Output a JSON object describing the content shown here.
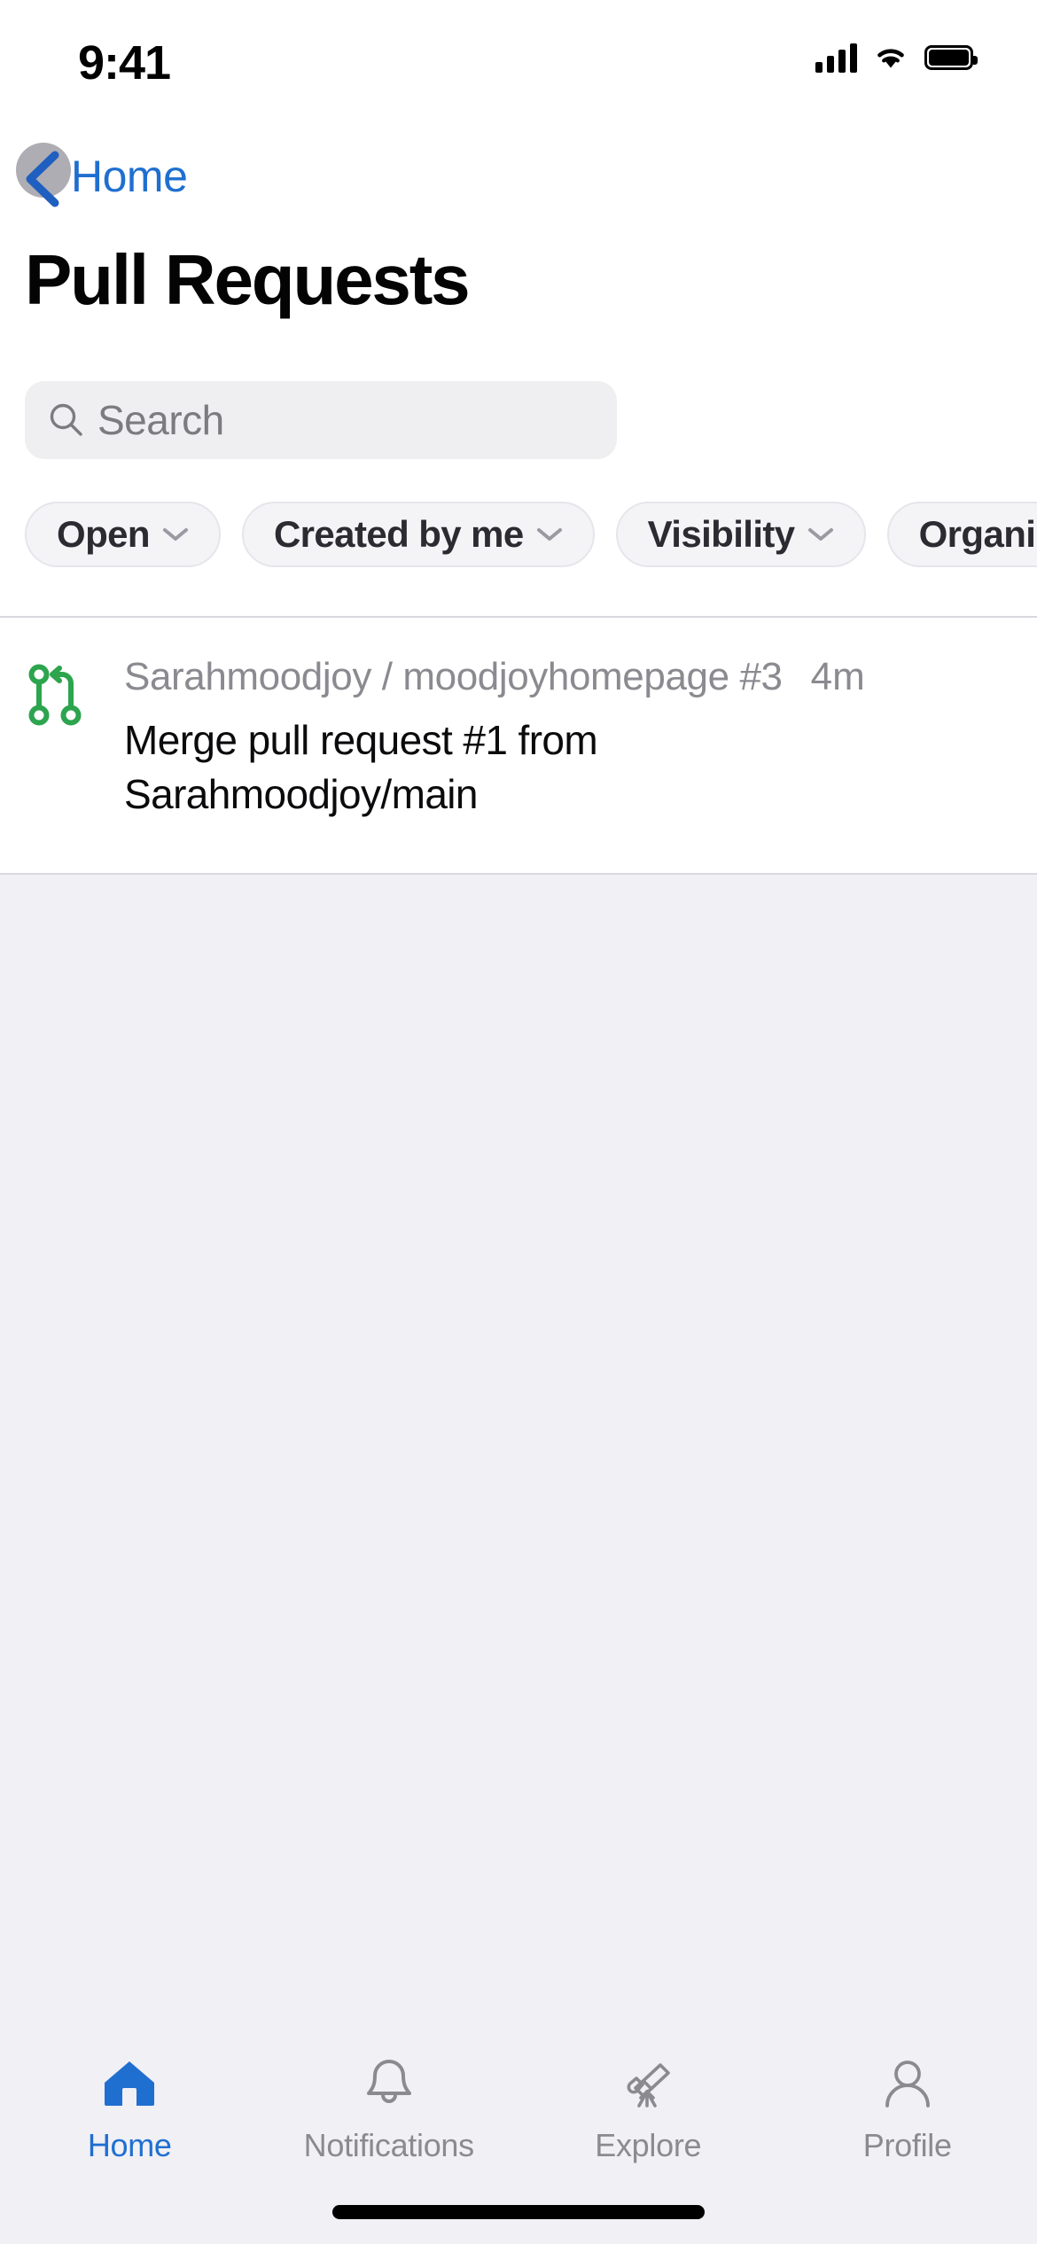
{
  "status_bar": {
    "time": "9:41",
    "cellular_icon": "signal-bars-icon",
    "wifi_icon": "wifi-icon",
    "battery_icon": "battery-full-icon"
  },
  "nav": {
    "back_label": "Home",
    "back_icon": "chevron-left-icon",
    "tap_indicator": "touch-highlight"
  },
  "header": {
    "title": "Pull Requests"
  },
  "search": {
    "placeholder": "Search",
    "value": "",
    "icon": "search-icon"
  },
  "filters": [
    {
      "label": "Open",
      "icon": "chevron-down-icon"
    },
    {
      "label": "Created by me",
      "icon": "chevron-down-icon"
    },
    {
      "label": "Visibility",
      "icon": "chevron-down-icon"
    },
    {
      "label": "Organizati",
      "icon": "chevron-down-icon"
    }
  ],
  "list": {
    "items": [
      {
        "icon": "git-pull-request-icon",
        "icon_color": "#2DA44E",
        "repo": "Sarahmoodjoy / moodjoyhomepage #3",
        "time": "4m",
        "title": "Merge pull request #1 from Sarahmoodjoy/main"
      }
    ]
  },
  "tab_bar": {
    "items": [
      {
        "label": "Home",
        "icon": "home-icon",
        "active": true
      },
      {
        "label": "Notifications",
        "icon": "bell-icon",
        "active": false
      },
      {
        "label": "Explore",
        "icon": "telescope-icon",
        "active": false
      },
      {
        "label": "Profile",
        "icon": "person-icon",
        "active": false
      }
    ]
  },
  "colors": {
    "accent_blue": "#1F6FD0",
    "green": "#2DA44E",
    "background": "#F0F0F5",
    "surface": "#FFFFFF",
    "muted_text": "#8A8A90"
  }
}
